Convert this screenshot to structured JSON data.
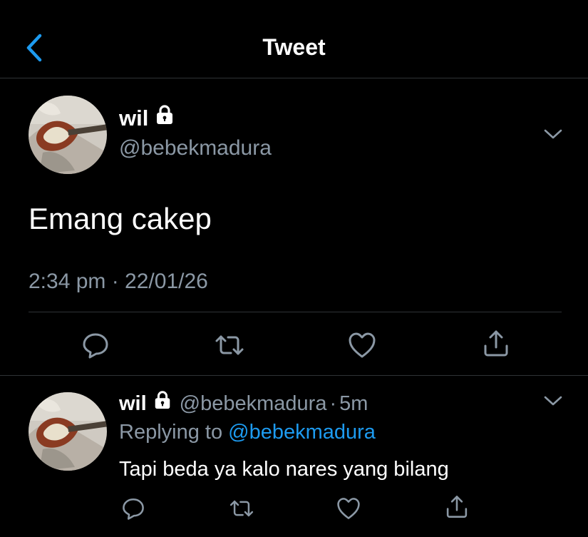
{
  "header": {
    "title": "Tweet"
  },
  "main_tweet": {
    "name": "wil",
    "handle": "@bebekmadura",
    "text": "Emang cakep",
    "timestamp": "2:34 pm · 22/01/26"
  },
  "reply_tweet": {
    "name": "wil",
    "handle": "@bebekmadura",
    "separator": "·",
    "time": "5m",
    "replying_prefix": "Replying to",
    "replying_to": "@bebekmadura",
    "text": "Tapi beda ya kalo nares yang bilang"
  },
  "colors": {
    "background": "#000000",
    "text": "#ffffff",
    "muted": "#8b98a5",
    "accent": "#1d9bf0",
    "divider": "#2f3336"
  },
  "icons": {
    "back": "chevron-left-icon",
    "lock": "lock-icon",
    "more": "chevron-down-icon",
    "reply": "speech-bubble-icon",
    "retweet": "retweet-icon",
    "like": "heart-icon",
    "share": "share-icon"
  }
}
